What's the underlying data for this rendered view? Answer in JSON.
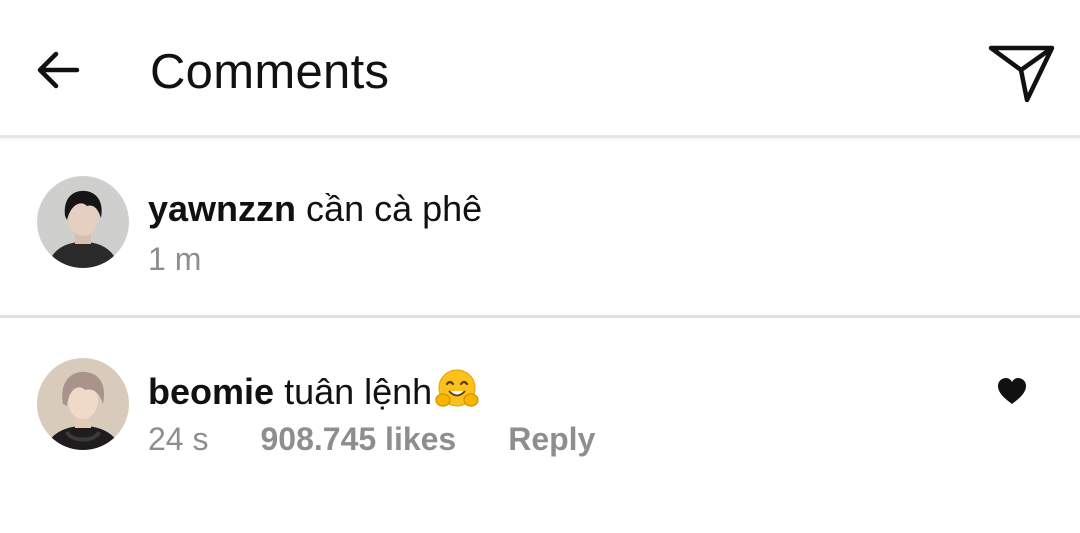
{
  "header": {
    "title": "Comments",
    "back_icon": "arrow-left-icon",
    "send_icon": "paper-plane-icon"
  },
  "comments": [
    {
      "username": "yawnzzn",
      "text": "cần cà phê",
      "time": "1 m"
    },
    {
      "username": "beomie",
      "text": "tuân lệnh",
      "emoji": "hugging-face-emoji",
      "time": "24 s",
      "likes": "908.745 likes",
      "reply_label": "Reply",
      "liked": true
    }
  ],
  "colors": {
    "text": "#111111",
    "meta": "#8e8e8e",
    "divider": "#e0e0e0",
    "background": "#ffffff"
  }
}
